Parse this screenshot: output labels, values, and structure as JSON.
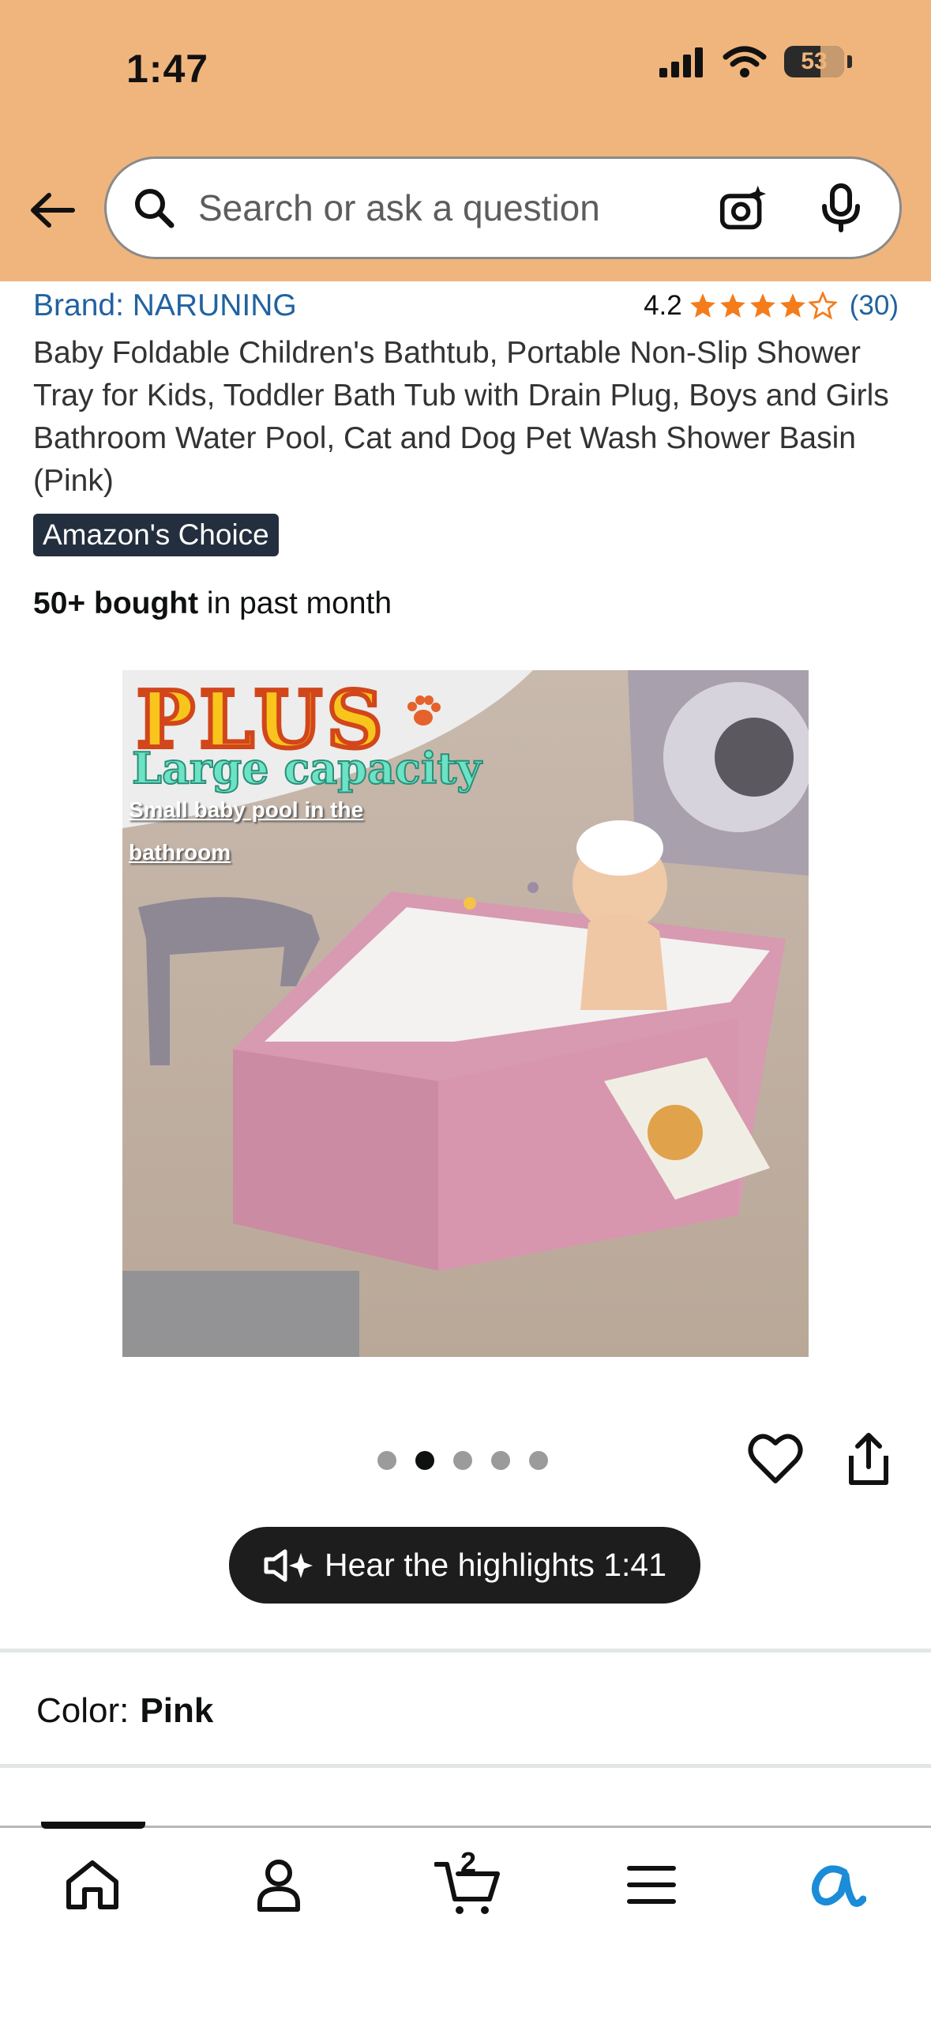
{
  "status_bar": {
    "time": "1:47",
    "battery": "53"
  },
  "search": {
    "placeholder": "Search or ask a question"
  },
  "product": {
    "brand": "Brand: NARUNING",
    "rating": "4.2",
    "rating_stars": 4.2,
    "rating_count": "(30)",
    "title": "Baby Foldable Children's Bathtub, Portable Non-Slip Shower Tray for Kids, Toddler Bath Tub with Drain Plug, Boys and Girls Bathroom Water Pool, Cat and Dog Pet Wash Shower Basin (Pink)",
    "badge": "Amazon's Choice",
    "bought_bold": "50+ bought",
    "bought_rest": " in past month"
  },
  "image": {
    "overlay_title": "PLUS",
    "overlay_caption": "Large capacity",
    "overlay_subtitle": "Small baby pool in the bathroom"
  },
  "carousel": {
    "count": 5,
    "active_index": 1
  },
  "highlights": {
    "label": "Hear the highlights 1:41"
  },
  "variation": {
    "label": "Color:",
    "value": "Pink"
  },
  "tabbar": {
    "items": [
      "home",
      "account",
      "cart",
      "menu",
      "rufus"
    ],
    "active_index": 0,
    "cart_count": "2"
  },
  "colors": {
    "header_bg": "#f0b57c",
    "link": "#2162a1",
    "star": "#f47c1b",
    "badge_bg": "#232f3e",
    "rufus_blue": "#1a8cd8"
  }
}
